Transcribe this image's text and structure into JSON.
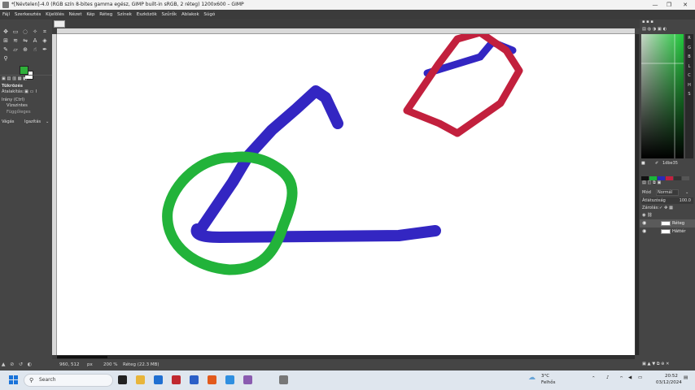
{
  "window": {
    "title": "*[Névtelen]-4.0 (RGB szín 8-bites gamma egész, GIMP built-in sRGB, 2 réteg) 1200x600 – GIMP",
    "controls": [
      "—",
      "❐",
      "✕"
    ]
  },
  "menu": [
    "Fájl",
    "Szerkesztés",
    "Kijelölés",
    "Nézet",
    "Kép",
    "Réteg",
    "Színek",
    "Eszközök",
    "Szűrők",
    "Ablakok",
    "Súgó"
  ],
  "toolbox": {
    "fg_color": "#2fb03a",
    "bg_color": "#ffffff",
    "options_title": "Tükrözés",
    "transform_label": "Átalakítás:",
    "direction_label": "Irány (Ctrl)",
    "dir_horizontal": "Vízszintes",
    "dir_vertical": "Függőleges",
    "clip_label": "Vágás",
    "clip_value": "Igazítás"
  },
  "canvas": {
    "strokes": [
      {
        "name": "blue-stroke",
        "color": "#3326c2"
      },
      {
        "name": "green-stroke",
        "color": "#22b33a"
      },
      {
        "name": "red-stroke",
        "color": "#c2203d"
      }
    ]
  },
  "status": {
    "coords": "960, 512",
    "unit": "px",
    "zoom": "200 %",
    "info": "Réteg (22.3 MB)"
  },
  "dock": {
    "channel_letters": [
      "R",
      "G",
      "B",
      "L",
      "C",
      "H",
      "S"
    ],
    "hex": "1dbe35",
    "mode_label": "Mód",
    "mode_value": "Normál",
    "opacity_label": "Átlátszóság",
    "opacity_value": "100.0",
    "lock_label": "Zárolás:",
    "layers": [
      {
        "name": "Réteg"
      },
      {
        "name": "Háttér"
      }
    ]
  },
  "taskbar": {
    "search_placeholder": "Search",
    "weather_temp": "3°C",
    "weather_desc": "Felhős",
    "time": "20:52",
    "date": "03/12/2024"
  }
}
